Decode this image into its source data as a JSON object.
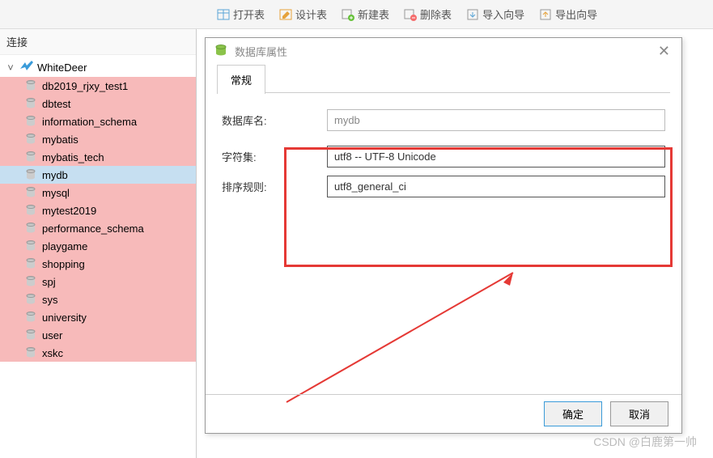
{
  "toolbar": {
    "open": "打开表",
    "design": "设计表",
    "new": "新建表",
    "delete": "删除表",
    "import": "导入向导",
    "export": "导出向导"
  },
  "sidebar": {
    "header": "连接",
    "connection": "WhiteDeer",
    "databases": [
      {
        "name": "db2019_rjxy_test1",
        "selected": false
      },
      {
        "name": "dbtest",
        "selected": false
      },
      {
        "name": "information_schema",
        "selected": false
      },
      {
        "name": "mybatis",
        "selected": false
      },
      {
        "name": "mybatis_tech",
        "selected": false
      },
      {
        "name": "mydb",
        "selected": true
      },
      {
        "name": "mysql",
        "selected": false
      },
      {
        "name": "mytest2019",
        "selected": false
      },
      {
        "name": "performance_schema",
        "selected": false
      },
      {
        "name": "playgame",
        "selected": false
      },
      {
        "name": "shopping",
        "selected": false
      },
      {
        "name": "spj",
        "selected": false
      },
      {
        "name": "sys",
        "selected": false
      },
      {
        "name": "university",
        "selected": false
      },
      {
        "name": "user",
        "selected": false
      },
      {
        "name": "xskc",
        "selected": false
      }
    ]
  },
  "dialog": {
    "title": "数据库属性",
    "tab": "常规",
    "fields": {
      "dbname_label": "数据库名:",
      "dbname_value": "mydb",
      "charset_label": "字符集:",
      "charset_value": "utf8 -- UTF-8 Unicode",
      "collation_label": "排序规则:",
      "collation_value": "utf8_general_ci"
    },
    "ok": "确定",
    "cancel": "取消"
  },
  "watermark": "CSDN @白鹿第一帅"
}
